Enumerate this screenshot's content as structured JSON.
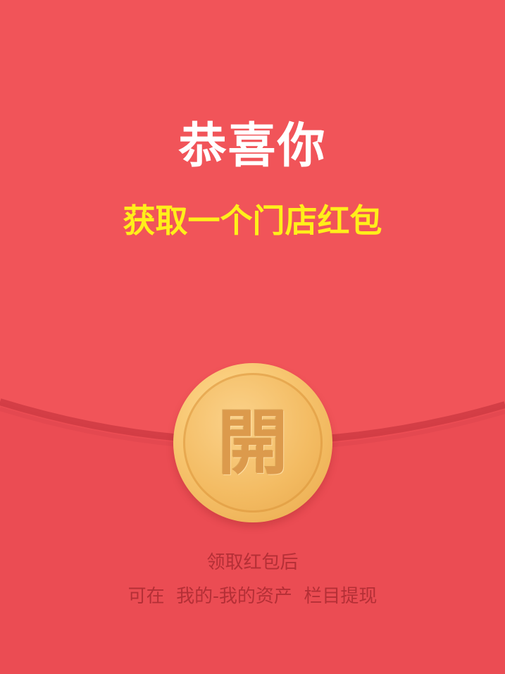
{
  "colors": {
    "background": "#eb4c53",
    "flap_fill": "#f15459",
    "flap_edge": "#cf3b43",
    "title": "#ffffff",
    "subtitle": "#ffef1a",
    "coin": "#f3bb62",
    "coin_char": "#dc9a4c",
    "note_text": "#b42f36"
  },
  "envelope": {
    "title": "恭喜你",
    "subtitle": "获取一个门店红包",
    "open_button_label": "開",
    "note_line1": "领取红包后",
    "note_line2": "可在  我的-我的资产  栏目提现"
  }
}
